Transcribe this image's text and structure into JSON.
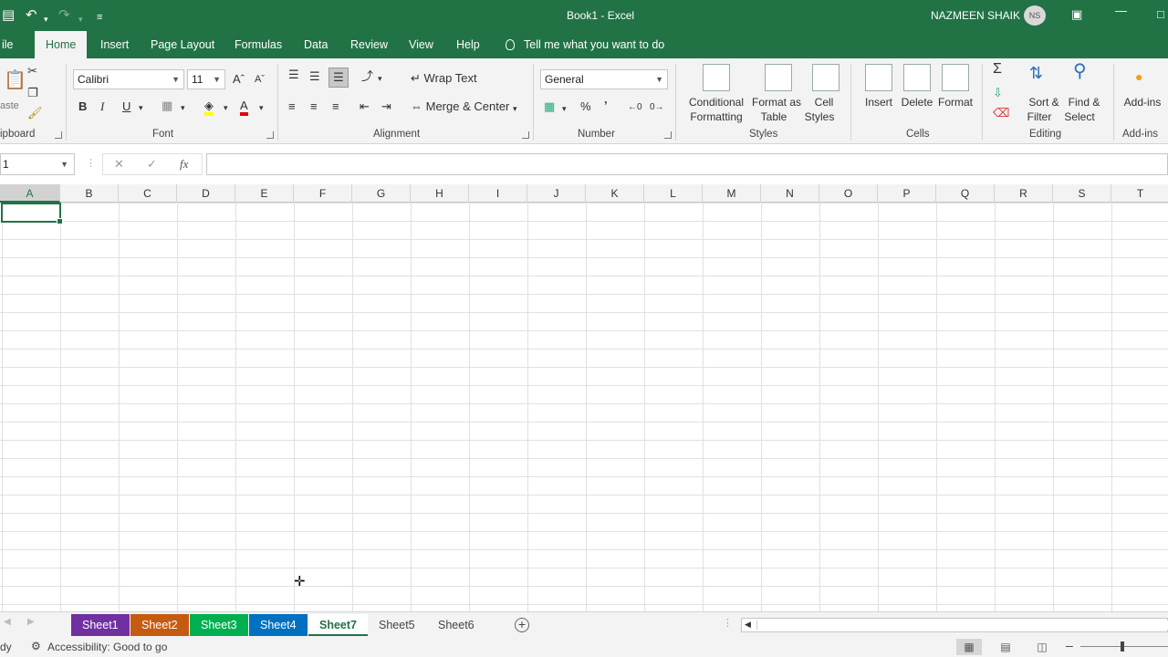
{
  "titlebar": {
    "title": "Book1  -  Excel",
    "user": "NAZMEEN SHAIK",
    "initials": "NS"
  },
  "ribbon_tabs": [
    "ile",
    "Home",
    "Insert",
    "Page Layout",
    "Formulas",
    "Data",
    "Review",
    "View",
    "Help"
  ],
  "tellme": "Tell me what you want to do",
  "ribbon": {
    "clipboard_label": "ipboard",
    "font_label": "Font",
    "font_name": "Calibri",
    "font_size": "11",
    "bold": "B",
    "italic": "I",
    "underline": "U",
    "alignment_label": "Alignment",
    "wrap_text": "Wrap Text",
    "merge_center": "Merge & Center",
    "number_label": "Number",
    "number_format": "General",
    "percent": "%",
    "comma": "’",
    "styles_label": "Styles",
    "cond_format_1": "Conditional",
    "cond_format_2": "Formatting",
    "format_table_1": "Format as",
    "format_table_2": "Table",
    "cell_styles_1": "Cell",
    "cell_styles_2": "Styles",
    "cells_label": "Cells",
    "insert": "Insert",
    "delete": "Delete",
    "format": "Format",
    "editing_label": "Editing",
    "sort_1": "Sort &",
    "sort_2": "Filter",
    "find_1": "Find &",
    "find_2": "Select",
    "addins": "Add-ins",
    "addins_label": "Add-ins",
    "paste_label": "aste"
  },
  "formula_bar": {
    "namebox": "1",
    "fx": "fx",
    "content": ""
  },
  "columns": [
    "A",
    "B",
    "C",
    "D",
    "E",
    "F",
    "G",
    "H",
    "I",
    "J",
    "K",
    "L",
    "M",
    "N",
    "O",
    "P",
    "Q",
    "R",
    "S",
    "T"
  ],
  "sheets": [
    {
      "name": "Sheet1",
      "color": "#7030a0"
    },
    {
      "name": "Sheet2",
      "color": "#c55a11"
    },
    {
      "name": "Sheet3",
      "color": "#00b050"
    },
    {
      "name": "Sheet4",
      "color": "#0070c0"
    },
    {
      "name": "Sheet7",
      "color": "#ffffff",
      "active": true
    },
    {
      "name": "Sheet5",
      "color": ""
    },
    {
      "name": "Sheet6",
      "color": ""
    }
  ],
  "statusbar": {
    "ready": "dy",
    "accessibility": "Accessibility: Good to go"
  },
  "colors": {
    "excel_green": "#217346"
  }
}
